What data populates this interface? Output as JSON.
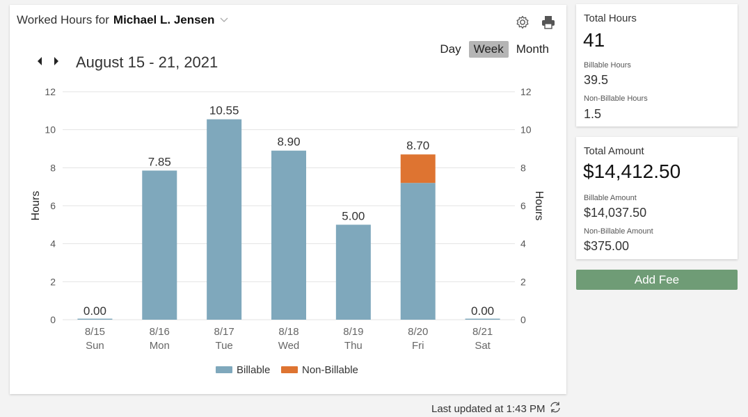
{
  "header": {
    "title_prefix": "Worked Hours for",
    "person": "Michael L. Jensen"
  },
  "icons": [
    "chevron-down-icon",
    "settings-icon",
    "print-icon",
    "arrow-left-icon",
    "arrow-right-icon",
    "refresh-icon"
  ],
  "period": {
    "day": "Day",
    "week": "Week",
    "month": "Month",
    "active": "week"
  },
  "date_range": "August 15 - 21, 2021",
  "colors": {
    "billable": "#7fa8bc",
    "non_billable": "#de7431",
    "accent_button": "#6f9c76"
  },
  "chart_data": {
    "type": "bar",
    "stacked": true,
    "categories": [
      "8/15",
      "8/16",
      "8/17",
      "8/18",
      "8/19",
      "8/20",
      "8/21"
    ],
    "weekdays": [
      "Sun",
      "Mon",
      "Tue",
      "Wed",
      "Thu",
      "Fri",
      "Sat"
    ],
    "series": [
      {
        "name": "Billable",
        "values": [
          0,
          7.85,
          10.55,
          8.9,
          5.0,
          7.2,
          0
        ]
      },
      {
        "name": "Non-Billable",
        "values": [
          0,
          0,
          0,
          0,
          0,
          1.5,
          0
        ]
      }
    ],
    "totals_labels": [
      "0.00",
      "7.85",
      "10.55",
      "8.90",
      "5.00",
      "8.70",
      "0.00"
    ],
    "ylabel": "Hours",
    "y2label": "Hours",
    "ylim": [
      0,
      12
    ],
    "yticks": [
      0,
      2,
      4,
      6,
      8,
      10,
      12
    ],
    "grid": true,
    "legend_position": "bottom"
  },
  "summary": {
    "hours": {
      "title": "Total Hours",
      "total": "41",
      "billable_label": "Billable Hours",
      "billable": "39.5",
      "non_billable_label": "Non-Billable Hours",
      "non_billable": "1.5"
    },
    "amount": {
      "title": "Total Amount",
      "total": "$14,412.50",
      "billable_label": "Billable Amount",
      "billable": "$14,037.50",
      "non_billable_label": "Non-Billable Amount",
      "non_billable": "$375.00"
    }
  },
  "add_fee": "Add Fee",
  "footer": {
    "last_updated": "Last updated at 1:43 PM"
  }
}
